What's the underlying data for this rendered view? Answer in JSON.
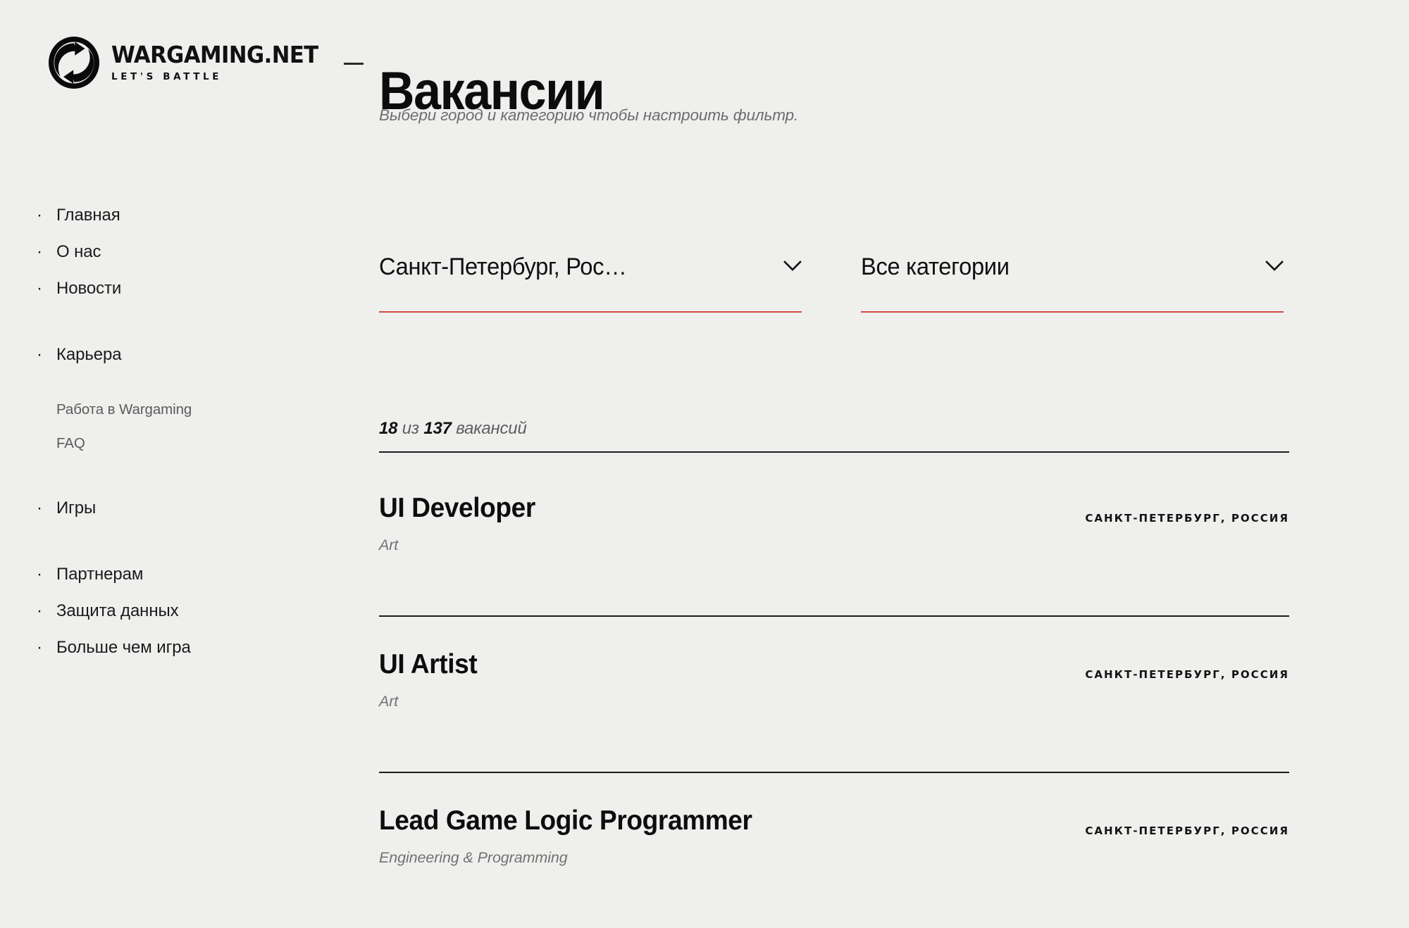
{
  "theme": {
    "background": "#efefee",
    "text": "#151515",
    "muted": "#6d6d6d",
    "accent_underline": "#d44a42",
    "divider": "#1d1d1d"
  },
  "brand": {
    "name": "WARGAMING.NET",
    "tagline": "LET'S BATTLE",
    "logo_icon": "wargaming-circle-arrows-icon"
  },
  "header": {
    "separator": "—",
    "title": "Вакансии",
    "subtitle": "Выбери город и категорию чтобы настроить фильтр."
  },
  "sidebar": {
    "bullet": "·",
    "groups": [
      {
        "items": [
          {
            "label": "Главная",
            "type": "link"
          },
          {
            "label": "О нас",
            "type": "link"
          },
          {
            "label": "Новости",
            "type": "link"
          }
        ]
      },
      {
        "items": [
          {
            "label": "Карьера",
            "type": "link"
          }
        ],
        "subitems": [
          {
            "label": "Работа в Wargaming"
          },
          {
            "label": "FAQ"
          }
        ]
      },
      {
        "items": [
          {
            "label": "Игры",
            "type": "link"
          }
        ]
      },
      {
        "items": [
          {
            "label": "Партнерам",
            "type": "link"
          },
          {
            "label": "Защита данных",
            "type": "link"
          },
          {
            "label": "Больше чем игра",
            "type": "link"
          }
        ]
      }
    ]
  },
  "filters": {
    "city": {
      "label": "city-select",
      "value": "Санкт-Петербург, Рос…",
      "icon": "chevron-down-icon"
    },
    "category": {
      "label": "category-select",
      "value": "Все категории",
      "icon": "chevron-down-icon"
    }
  },
  "results": {
    "shown": "18",
    "of_word": "из",
    "total": "137",
    "unit_word": "вакансий"
  },
  "jobs": [
    {
      "title": "UI Developer",
      "category": "Art",
      "location": "САНКТ-ПЕТЕРБУРГ, РОССИЯ"
    },
    {
      "title": "UI Artist",
      "category": "Art",
      "location": "САНКТ-ПЕТЕРБУРГ, РОССИЯ"
    },
    {
      "title": "Lead Game Logic Programmer",
      "category": "Engineering & Programming",
      "location": "САНКТ-ПЕТЕРБУРГ, РОССИЯ"
    }
  ]
}
